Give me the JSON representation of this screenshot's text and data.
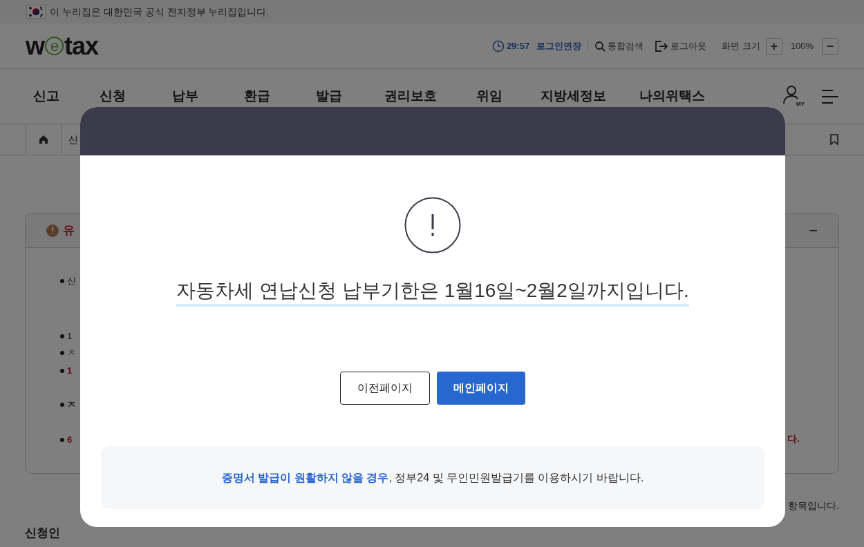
{
  "gov_banner": {
    "text": "이 누리집은 대한민국 공식 전자정부 누리집입니다."
  },
  "header": {
    "logo": {
      "before": "w",
      "mark": "e",
      "after": "tax"
    },
    "timer": "29:57",
    "extend_login": "로그인연장",
    "search": "통합검색",
    "logout": "로그아웃",
    "zoom_label": "화면 크기",
    "zoom_in": "+",
    "zoom_value": "100%",
    "zoom_out": "−"
  },
  "nav": [
    {
      "label": "신고"
    },
    {
      "label": "신청"
    },
    {
      "label": "납부"
    },
    {
      "label": "환급"
    },
    {
      "label": "발급"
    },
    {
      "label": "권리보호"
    },
    {
      "label": "위임"
    },
    {
      "label": "지방세정보"
    },
    {
      "label": "나의위택스"
    }
  ],
  "my_label": "MY",
  "breadcrumb": {
    "current": "신"
  },
  "notice_card": {
    "title": "유",
    "bullets": [
      {
        "text": "신",
        "kind": "normal"
      },
      {
        "text": "1",
        "kind": "normal"
      },
      {
        "text": "ㅊ",
        "kind": "normal"
      },
      {
        "text": "1",
        "kind": "warning"
      },
      {
        "text": "ㅈ",
        "kind": "strong"
      },
      {
        "text": "6",
        "kind": "warning"
      }
    ],
    "right_fragment": "다.",
    "collapse": "−"
  },
  "required_note": "항목입니다.",
  "section_title": "신청인",
  "modal": {
    "message": "자동차세 연납신청 납부기한은 1월16일~2월2일까지입니다.",
    "buttons": [
      {
        "label": "이전페이지",
        "kind": "secondary"
      },
      {
        "label": "메인페이지",
        "kind": "primary"
      }
    ],
    "info": "**증명서 발급이 원활하지 않을 경우**, 정부24 및 무인민원발급기를 이용하시기 바랍니다."
  }
}
